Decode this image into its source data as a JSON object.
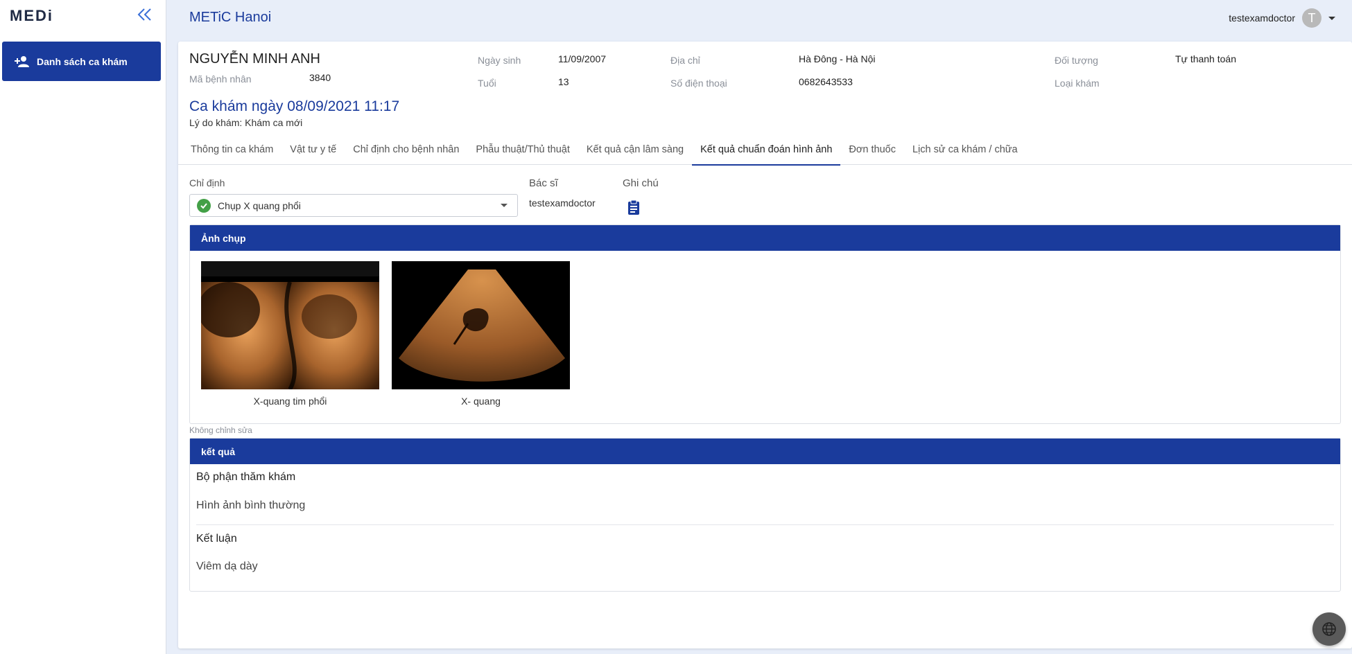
{
  "brand": {
    "logo": "MEDi"
  },
  "sidebar": {
    "items": [
      {
        "label": "Danh sách ca khám"
      }
    ]
  },
  "header": {
    "title": "METiC Hanoi",
    "user": "testexamdoctor",
    "avatar_letter": "T"
  },
  "patient": {
    "name": "NGUYỄN MINH ANH",
    "id_label": "Mã bệnh nhân",
    "id_value": "3840",
    "dob_label": "Ngày sinh",
    "dob_value": "11/09/2007",
    "age_label": "Tuổi",
    "age_value": "13",
    "address_label": "Địa chỉ",
    "address_value": "Hà Đông - Hà Nội",
    "phone_label": "Số điện thoại",
    "phone_value": "0682643533",
    "subject_label": "Đối tượng",
    "subject_value": "Tự thanh toán",
    "exam_type_label": "Loại khám"
  },
  "session": {
    "title": "Ca khám ngày 08/09/2021 11:17",
    "reason": "Lý do khám: Khám ca mới"
  },
  "tabs": [
    {
      "label": "Thông tin ca khám"
    },
    {
      "label": "Vật tư y tế"
    },
    {
      "label": "Chỉ định cho bệnh nhân"
    },
    {
      "label": "Phẫu thuật/Thủ thuật"
    },
    {
      "label": "Kết quả cận lâm sàng"
    },
    {
      "label": "Kết quả chuẩn đoán hình ảnh",
      "active": true
    },
    {
      "label": "Đơn thuốc"
    },
    {
      "label": "Lịch sử ca khám / chữa"
    }
  ],
  "form": {
    "indication_label": "Chỉ định",
    "indication_value": "Chụp X quang phổi",
    "doctor_label": "Bác sĩ",
    "doctor_value": "testexamdoctor",
    "note_label": "Ghi chú"
  },
  "images_panel": {
    "title": "Ảnh chụp",
    "items": [
      {
        "caption": "X-quang tim phổi"
      },
      {
        "caption": "X- quang"
      }
    ]
  },
  "readonly_hint": "Không chỉnh sửa",
  "results_panel": {
    "title": "kết quả",
    "part_label": "Bộ phận thăm khám",
    "part_value": "Hình ảnh bình thường",
    "conclusion_label": "Kết luận",
    "conclusion_value": "Viêm dạ dày"
  },
  "colors": {
    "primary": "#1a3b9c",
    "background": "#e8eef9",
    "success": "#43a047"
  },
  "icons": [
    "add-user-icon",
    "double-chevron-left-icon",
    "check-circle-icon",
    "clipboard-icon",
    "globe-icon",
    "chevron-down-icon"
  ]
}
